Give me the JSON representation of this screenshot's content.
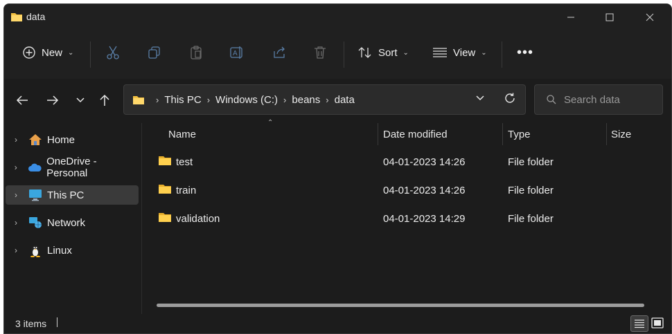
{
  "window": {
    "title": "data"
  },
  "toolbar": {
    "new_label": "New",
    "sort_label": "Sort",
    "view_label": "View"
  },
  "address": {
    "crumbs": [
      "This PC",
      "Windows (C:)",
      "beans",
      "data"
    ]
  },
  "search": {
    "placeholder": "Search data"
  },
  "sidebar": {
    "items": [
      {
        "label": "Home",
        "icon": "home-icon"
      },
      {
        "label": "OneDrive - Personal",
        "icon": "cloud-icon"
      },
      {
        "label": "This PC",
        "icon": "monitor-icon",
        "selected": true
      },
      {
        "label": "Network",
        "icon": "network-icon"
      },
      {
        "label": "Linux",
        "icon": "penguin-icon"
      }
    ]
  },
  "columns": {
    "name": "Name",
    "date": "Date modified",
    "type": "Type",
    "size": "Size"
  },
  "files": [
    {
      "name": "test",
      "date": "04-01-2023 14:26",
      "type": "File folder"
    },
    {
      "name": "train",
      "date": "04-01-2023 14:26",
      "type": "File folder"
    },
    {
      "name": "validation",
      "date": "04-01-2023 14:29",
      "type": "File folder"
    }
  ],
  "status": {
    "count": "3 items"
  },
  "colors": {
    "background": "#1c1c1c",
    "folder": "#f5c242",
    "accent": "#3a3a3a"
  }
}
